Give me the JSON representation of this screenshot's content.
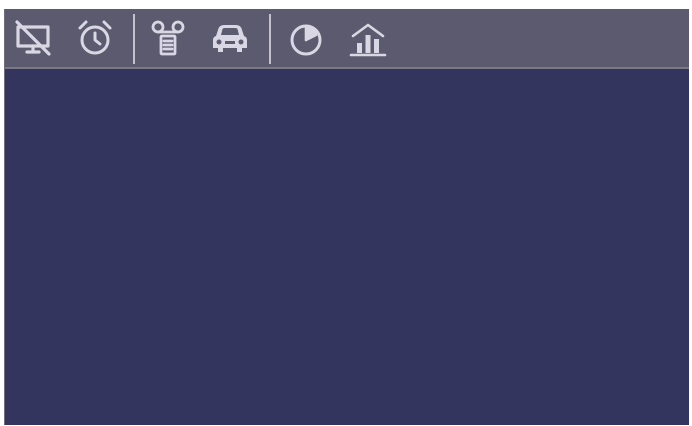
{
  "toolbar": {
    "tools": [
      {
        "icon": "monitor-off-icon"
      },
      {
        "icon": "alarm-clock-icon"
      },
      {
        "icon": "voicemail-icon"
      },
      {
        "icon": "car-icon"
      },
      {
        "icon": "pie-chart-icon"
      },
      {
        "icon": "bar-chart-icon"
      }
    ]
  },
  "colors": {
    "toolbar_bg": "#5c5a6e",
    "canvas_bg": "#34355f",
    "icon": "#d9d7e3"
  }
}
